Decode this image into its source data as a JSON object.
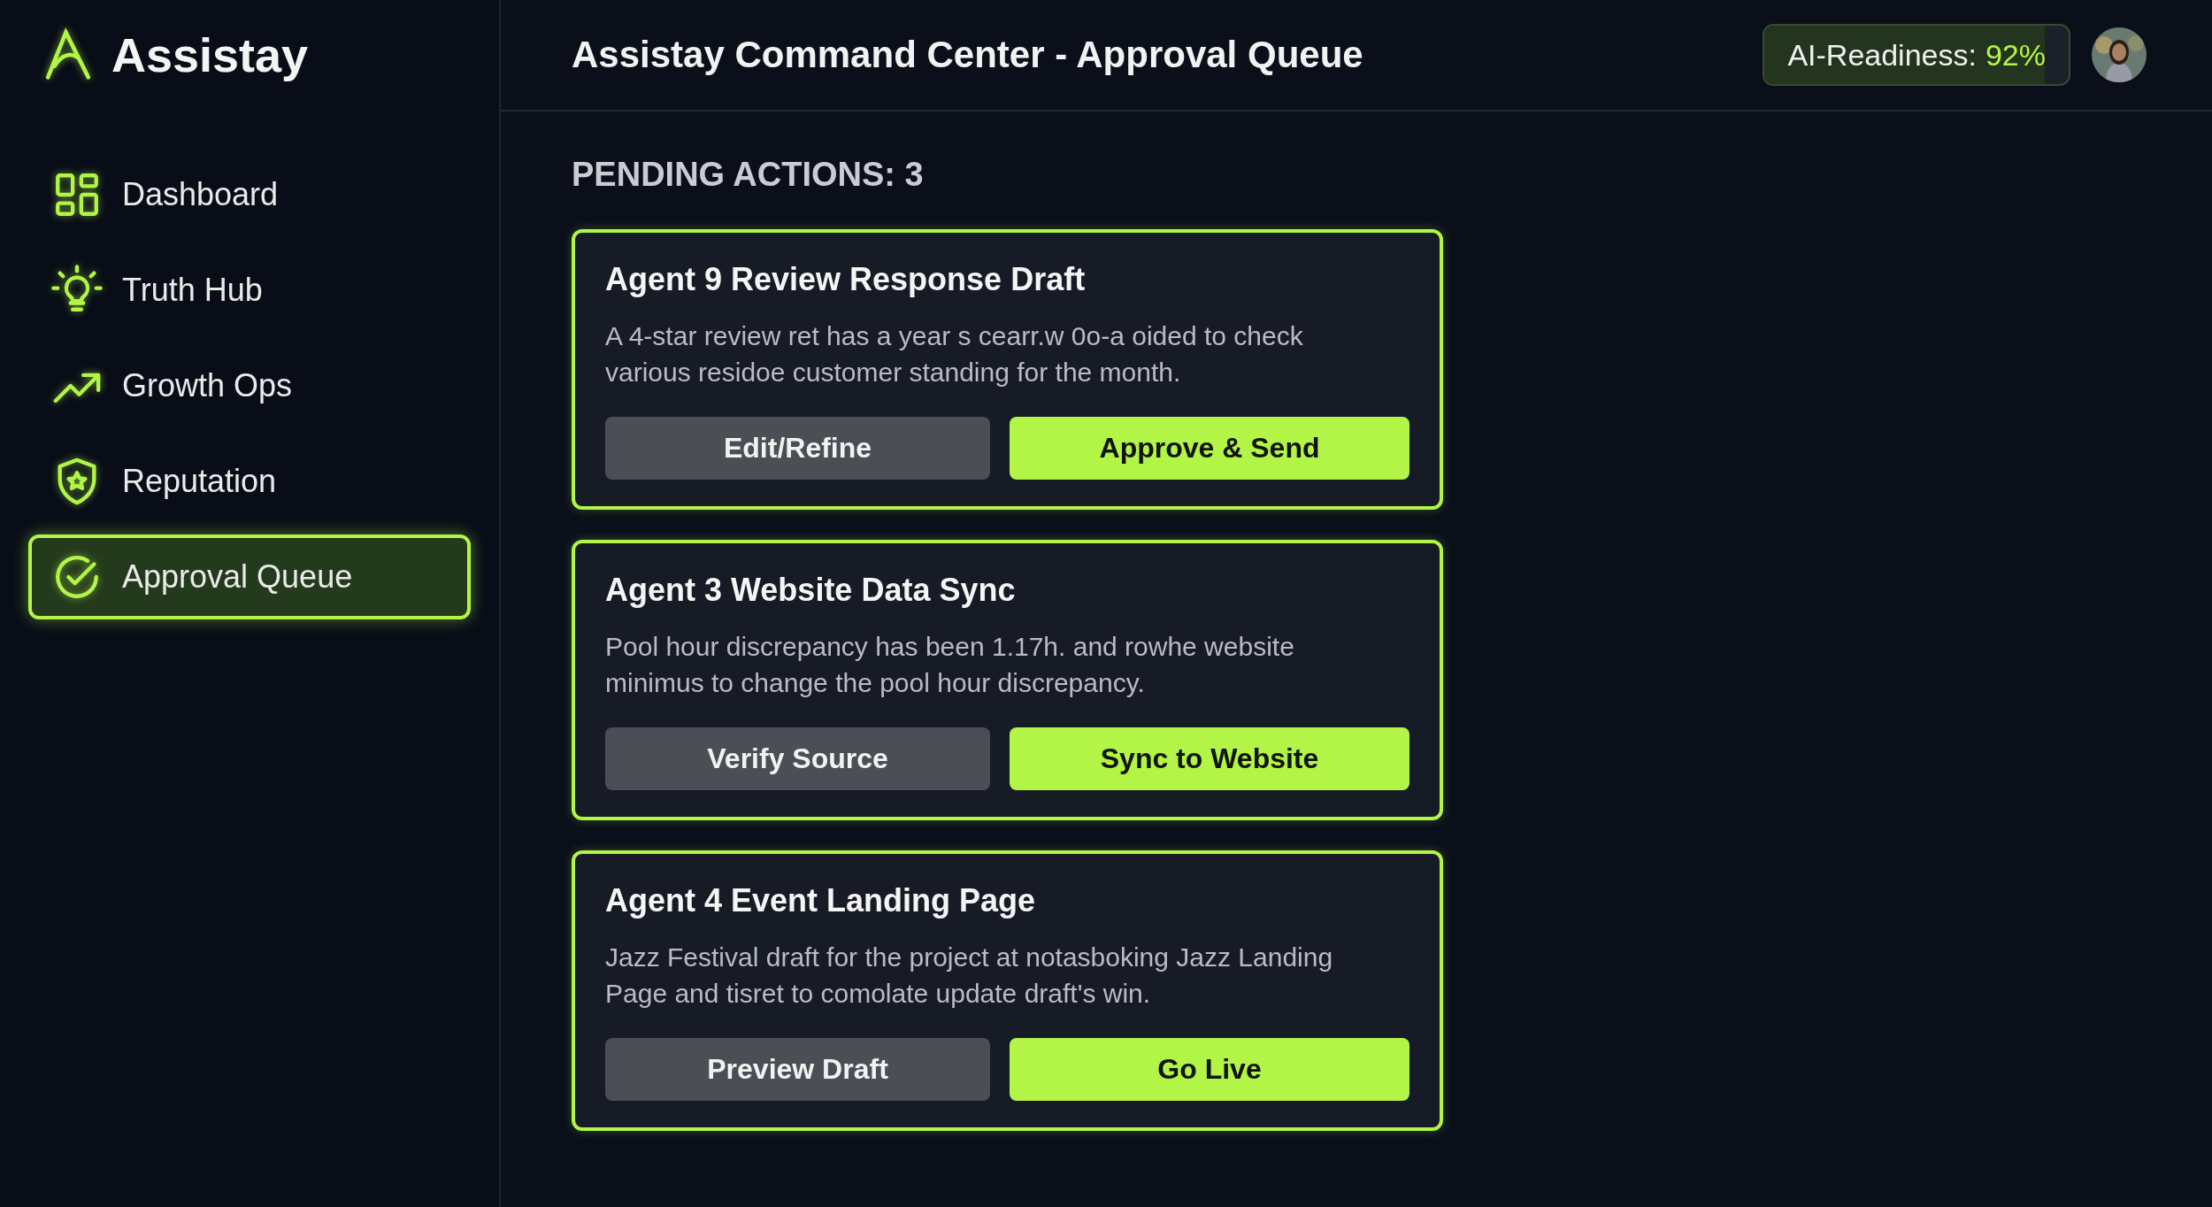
{
  "sidebar": {
    "brand": "Assistay",
    "items": [
      {
        "label": "Dashboard",
        "selected": false
      },
      {
        "label": "Truth Hub",
        "selected": false
      },
      {
        "label": "Growth Ops",
        "selected": false
      },
      {
        "label": "Reputation",
        "selected": false
      },
      {
        "label": "Approval Queue",
        "selected": true
      }
    ]
  },
  "header": {
    "title": "Assistay Command Center - Approval Queue",
    "readiness": {
      "label": "AI-Readiness:",
      "value": "92%",
      "level": 0.92
    }
  },
  "pending_title": "PENDING ACTIONS: 3",
  "cards": [
    {
      "title": "Agent 9 Review Response Draft",
      "text": "A 4-star review ret has a year s cearr.w 0o-a oided to check various residoe customer standing for the month.",
      "buttons": [
        {
          "label": "Edit/Refine",
          "kind": "secondary"
        },
        {
          "label": "Approve & Send",
          "kind": "primary"
        }
      ]
    },
    {
      "title": "Agent 3 Website Data Sync",
      "text": "Pool hour discrepancy has been 1.17h. and rowhe website minimus to change the pool hour discrepancy.",
      "buttons": [
        {
          "label": "Verify Source",
          "kind": "secondary"
        },
        {
          "label": "Sync to Website",
          "kind": "primary"
        }
      ]
    },
    {
      "title": "Agent 4 Event Landing Page",
      "text": "Jazz Festival draft for the project at notasboking Jazz Landing Page and tisret to comolate update draft's win.",
      "buttons": [
        {
          "label": "Preview Draft",
          "kind": "secondary"
        },
        {
          "label": "Go Live",
          "kind": "primary"
        }
      ]
    }
  ]
}
